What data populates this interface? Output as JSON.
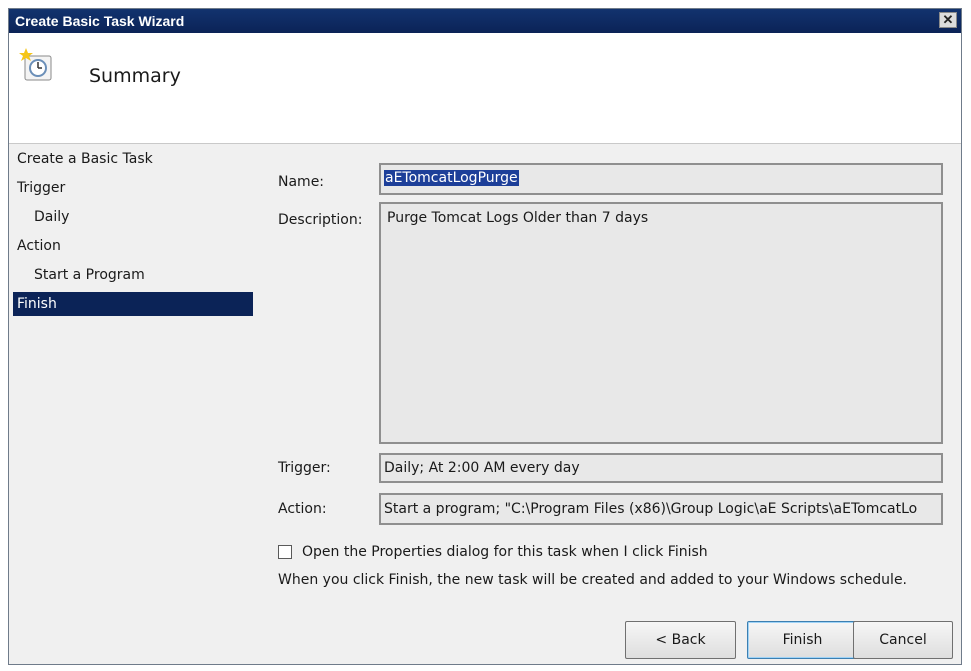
{
  "window": {
    "title": "Create Basic Task Wizard",
    "close_label": "✕"
  },
  "header": {
    "title": "Summary",
    "icon": "task-clock-icon"
  },
  "steps": [
    {
      "label": "Create a Basic Task"
    },
    {
      "label": "Trigger"
    },
    {
      "label": "Daily"
    },
    {
      "label": "Action"
    },
    {
      "label": "Start a Program"
    },
    {
      "label": "Finish"
    }
  ],
  "form": {
    "name_label": "Name:",
    "name_value": "aETomcatLogPurge",
    "description_label": "Description:",
    "description_value": "Purge Tomcat Logs Older than 7 days",
    "trigger_label": "Trigger:",
    "trigger_value": "Daily; At 2:00 AM every day",
    "action_label": "Action:",
    "action_value": "Start a program; \"C:\\Program Files (x86)\\Group Logic\\aE Scripts\\aETomcatLo",
    "open_properties_label": "Open the Properties dialog for this task when I click Finish",
    "open_properties_checked": false,
    "info_text": "When you click Finish, the new task will be created and added to your Windows schedule."
  },
  "buttons": {
    "back": "< Back",
    "finish": "Finish",
    "cancel": "Cancel"
  },
  "colors": {
    "title_bar": "#0b2357",
    "selected_step": "#0b2357",
    "selection": "#1d3f99"
  }
}
